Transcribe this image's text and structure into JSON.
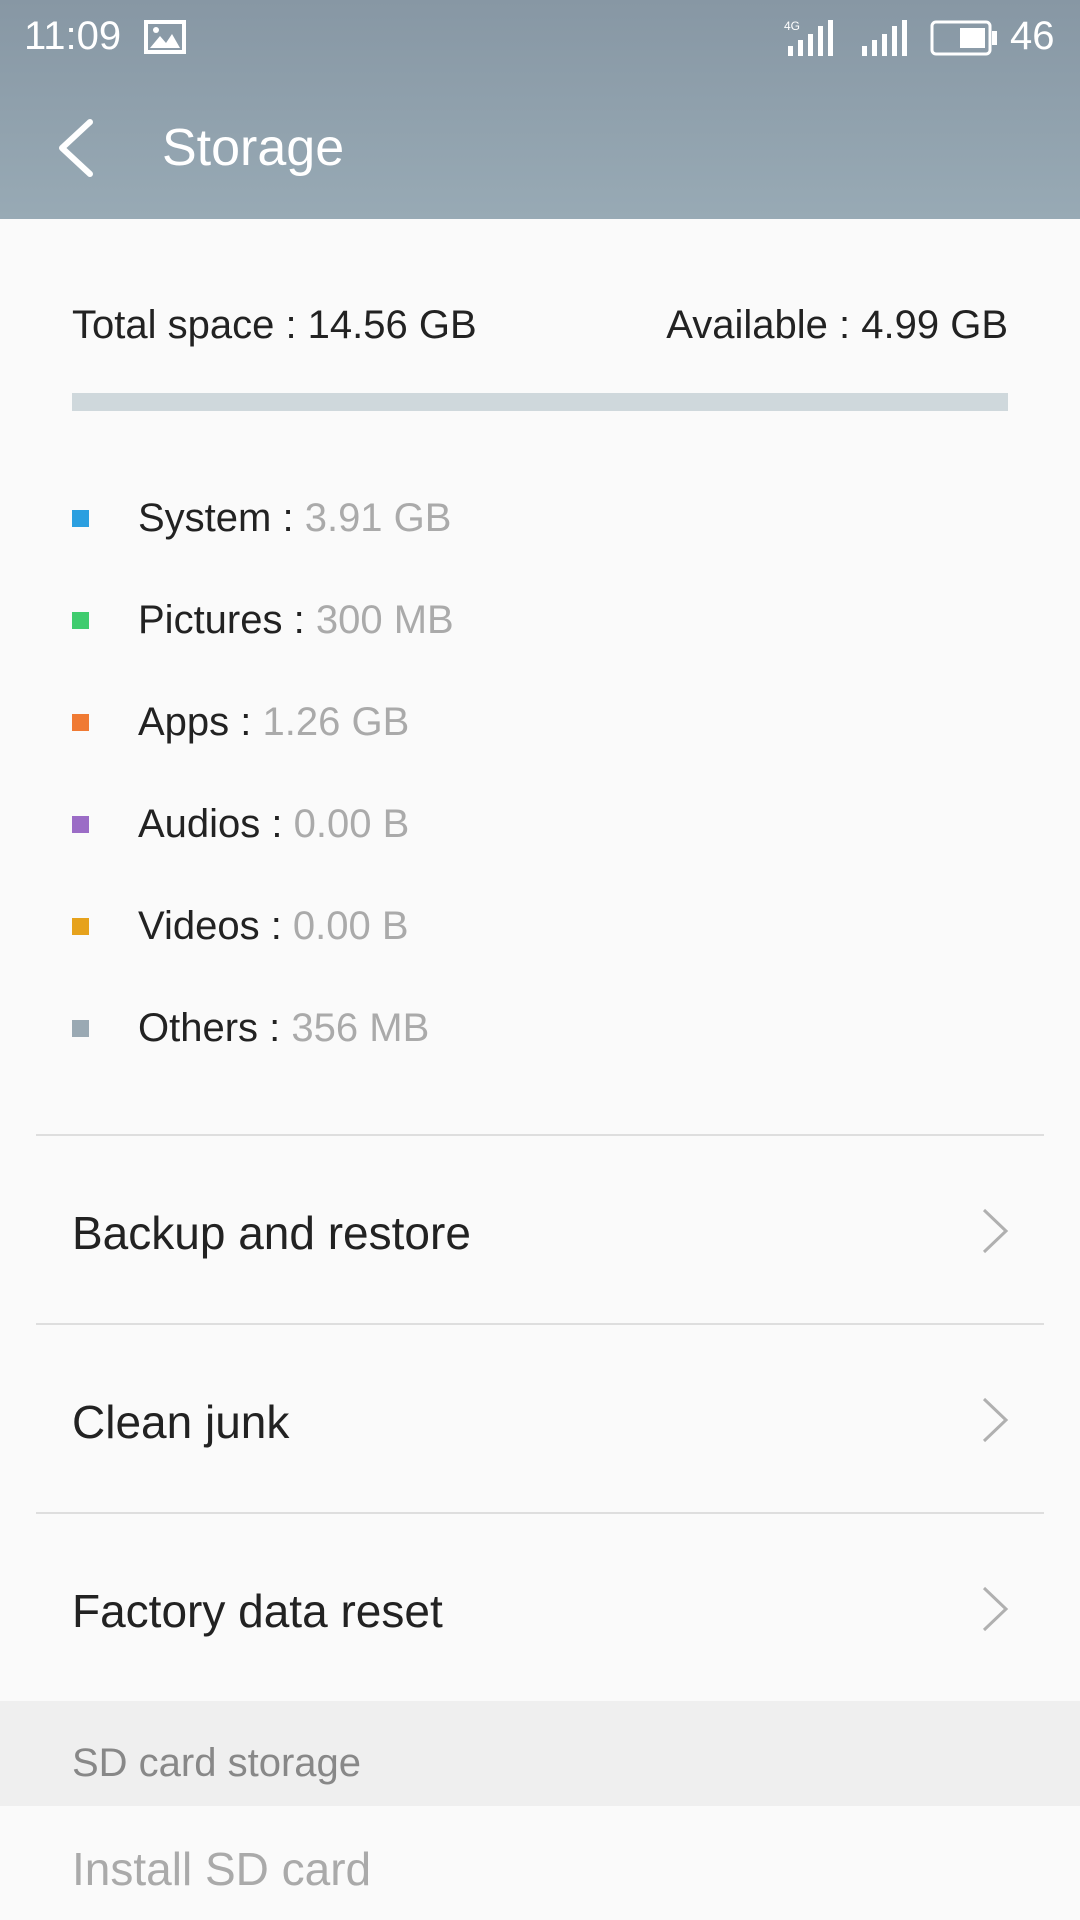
{
  "status_bar": {
    "time": "11:09",
    "network_type": "4G",
    "battery_level": "46",
    "icons": [
      "gallery-icon",
      "signal-4g-icon",
      "signal-icon",
      "battery-icon"
    ]
  },
  "header": {
    "title": "Storage",
    "back_icon": "back-arrow-icon"
  },
  "summary": {
    "total": "Total space : 14.56 GB",
    "available": "Available : 4.99 GB"
  },
  "categories": [
    {
      "label": "System : ",
      "value": "3.91 GB",
      "color": "#2b9fe0"
    },
    {
      "label": "Pictures : ",
      "value": "300 MB",
      "color": "#3fcc6e"
    },
    {
      "label": "Apps : ",
      "value": "1.26 GB",
      "color": "#f07a33"
    },
    {
      "label": "Audios : ",
      "value": "0.00 B",
      "color": "#9b6cc6"
    },
    {
      "label": "Videos : ",
      "value": "0.00 B",
      "color": "#e6a21c"
    },
    {
      "label": "Others : ",
      "value": "356 MB",
      "color": "#9aa9b3"
    }
  ],
  "menu": [
    {
      "label": "Backup and restore"
    },
    {
      "label": "Clean junk"
    },
    {
      "label": "Factory data reset"
    }
  ],
  "sd_section": {
    "title": "SD card storage",
    "install_label": "Install SD card"
  },
  "colors": {
    "header_top": "#8797a4",
    "header_bottom": "#98aab5",
    "usage_bar": "#cfd8dc",
    "secondary_text": "#aaaaaa"
  }
}
